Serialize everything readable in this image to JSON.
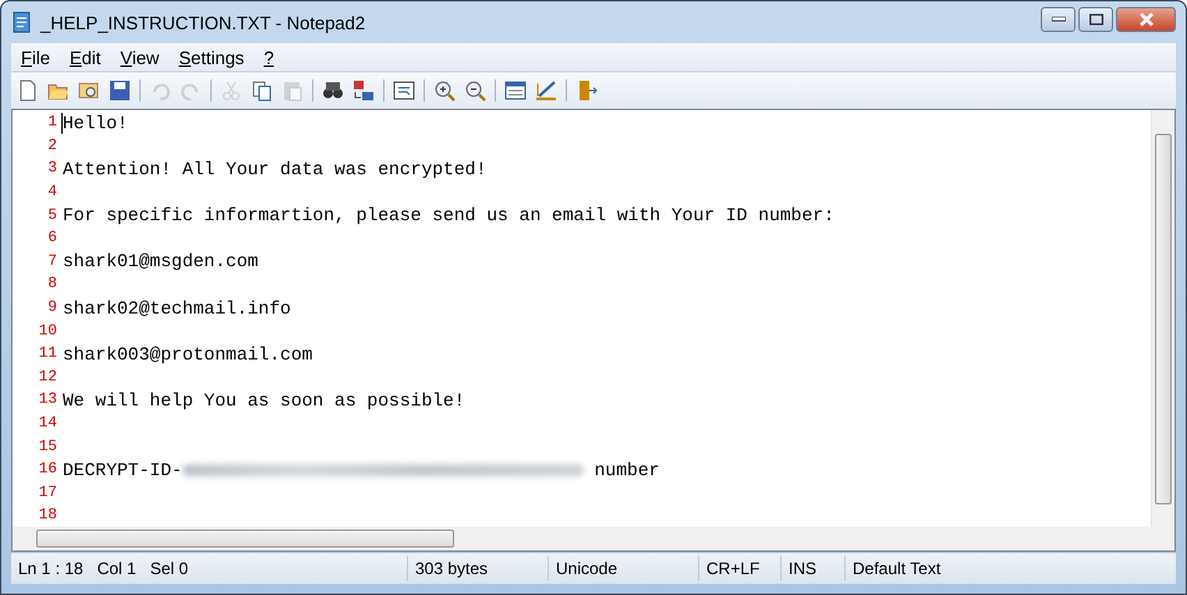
{
  "window": {
    "title": "_HELP_INSTRUCTION.TXT - Notepad2"
  },
  "menu": [
    {
      "label": "File"
    },
    {
      "label": "Edit"
    },
    {
      "label": "View"
    },
    {
      "label": "Settings"
    },
    {
      "label": "?"
    }
  ],
  "toolbar": [
    [
      {
        "kind": "new",
        "disabled": false
      },
      {
        "kind": "open",
        "disabled": false
      },
      {
        "kind": "browse",
        "disabled": false
      },
      {
        "kind": "save",
        "disabled": false
      }
    ],
    [
      {
        "kind": "undo",
        "disabled": true
      },
      {
        "kind": "redo",
        "disabled": true
      }
    ],
    [
      {
        "kind": "cut",
        "disabled": true
      },
      {
        "kind": "copy",
        "disabled": false
      },
      {
        "kind": "paste",
        "disabled": true
      }
    ],
    [
      {
        "kind": "find",
        "disabled": false
      },
      {
        "kind": "replace",
        "disabled": false
      }
    ],
    [
      {
        "kind": "wrap",
        "disabled": false
      }
    ],
    [
      {
        "kind": "zoom-in",
        "disabled": false
      },
      {
        "kind": "zoom-out",
        "disabled": false
      }
    ],
    [
      {
        "kind": "scheme",
        "disabled": false
      },
      {
        "kind": "customize",
        "disabled": false
      }
    ],
    [
      {
        "kind": "exit",
        "disabled": false
      }
    ]
  ],
  "editor": {
    "lines": [
      {
        "number": "1",
        "caret": true,
        "segments": [
          {
            "kind": "text",
            "text": "Hello!"
          }
        ]
      },
      {
        "number": "2",
        "caret": false
      },
      {
        "number": "3",
        "caret": false,
        "segments": [
          {
            "kind": "text",
            "text": "Attention! All Your data was encrypted!"
          }
        ]
      },
      {
        "number": "4",
        "caret": false
      },
      {
        "number": "5",
        "caret": false,
        "segments": [
          {
            "kind": "text",
            "text": "For specific informartion, please send us an email with Your ID number:"
          }
        ]
      },
      {
        "number": "6",
        "caret": false
      },
      {
        "number": "7",
        "caret": false,
        "segments": [
          {
            "kind": "text",
            "text": "shark01@msgden.com"
          }
        ]
      },
      {
        "number": "8",
        "caret": false
      },
      {
        "number": "9",
        "caret": false,
        "segments": [
          {
            "kind": "text",
            "text": "shark02@techmail.info"
          }
        ]
      },
      {
        "number": "10",
        "caret": false
      },
      {
        "number": "11",
        "caret": false,
        "segments": [
          {
            "kind": "text",
            "text": "shark003@protonmail.com"
          }
        ]
      },
      {
        "number": "12",
        "caret": false
      },
      {
        "number": "13",
        "caret": false,
        "segments": [
          {
            "kind": "text",
            "text": "We will help You as soon as possible!"
          }
        ]
      },
      {
        "number": "14",
        "caret": false
      },
      {
        "number": "15",
        "caret": false
      },
      {
        "number": "16",
        "caret": false,
        "segments": [
          {
            "kind": "text",
            "text": "DECRYPT-ID-"
          },
          {
            "kind": "blurred"
          },
          {
            "kind": "text",
            "text": " number"
          }
        ]
      },
      {
        "number": "17",
        "caret": false
      },
      {
        "number": "18",
        "caret": false
      }
    ]
  },
  "status_bar": [
    {
      "text": "Ln 1 : 18   Col 1   Sel 0"
    },
    {
      "text": "303 bytes"
    },
    {
      "text": "Unicode"
    },
    {
      "text": "CR+LF"
    },
    {
      "text": "INS"
    },
    {
      "text": "Default Text"
    }
  ]
}
